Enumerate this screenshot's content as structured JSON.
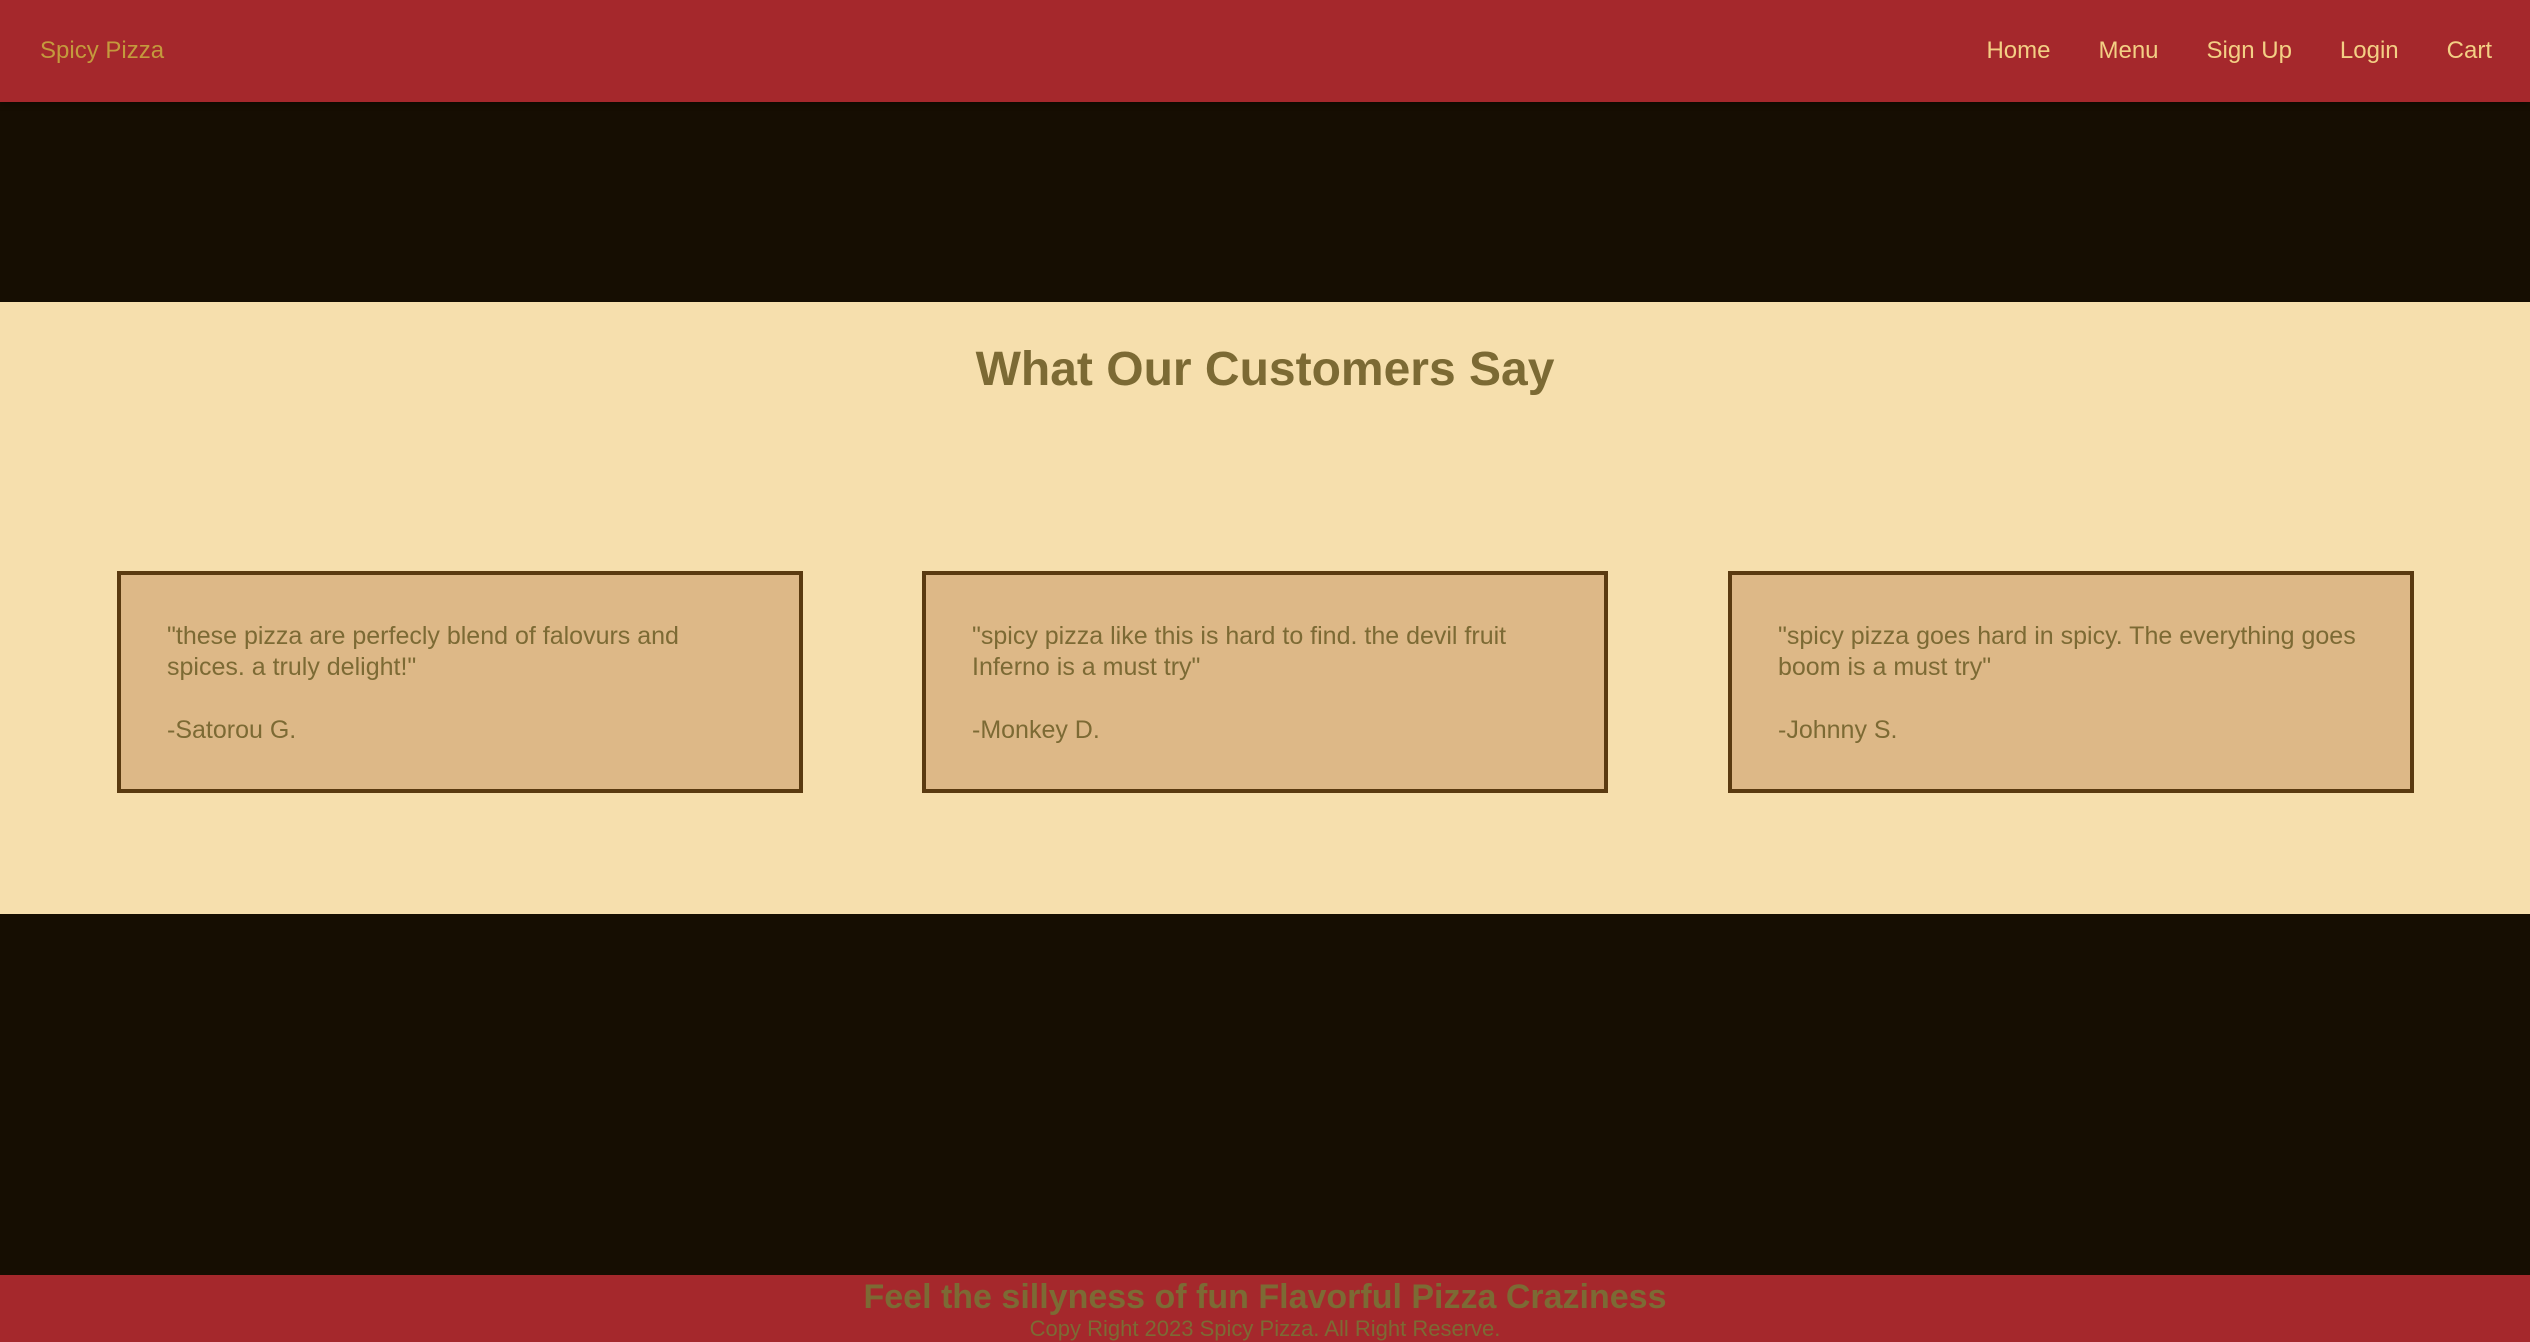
{
  "colors": {
    "navbar_bg": "#a5282c",
    "brand_text": "#c49a3d",
    "nav_link_text": "#f3cf84",
    "dark_bg": "#160e02",
    "section_bg": "#f6dfad",
    "card_bg": "#ddb887",
    "card_border": "#5a3a10",
    "muted_text": "#7c6a34"
  },
  "navbar": {
    "brand": "Spicy Pizza",
    "links": [
      "Home",
      "Menu",
      "Sign Up",
      "Login",
      "Cart"
    ]
  },
  "testimonials": {
    "title": "What Our Customers Say",
    "cards": [
      {
        "quote": "\"these pizza are perfecly blend of falovurs and spices. a truly delight!\"",
        "author": "-Satorou G."
      },
      {
        "quote": "\"spicy pizza like this is hard to find. the devil fruit Inferno is a must try\"",
        "author": "-Monkey D."
      },
      {
        "quote": "\"spicy pizza goes hard in spicy. The everything goes boom is a must try\"",
        "author": "-Johnny S."
      }
    ]
  },
  "footer": {
    "tagline": "Feel the sillyness of fun Flavorful Pizza Craziness",
    "copyright": "Copy Right 2023 Spicy Pizza. All Right Reserve."
  }
}
